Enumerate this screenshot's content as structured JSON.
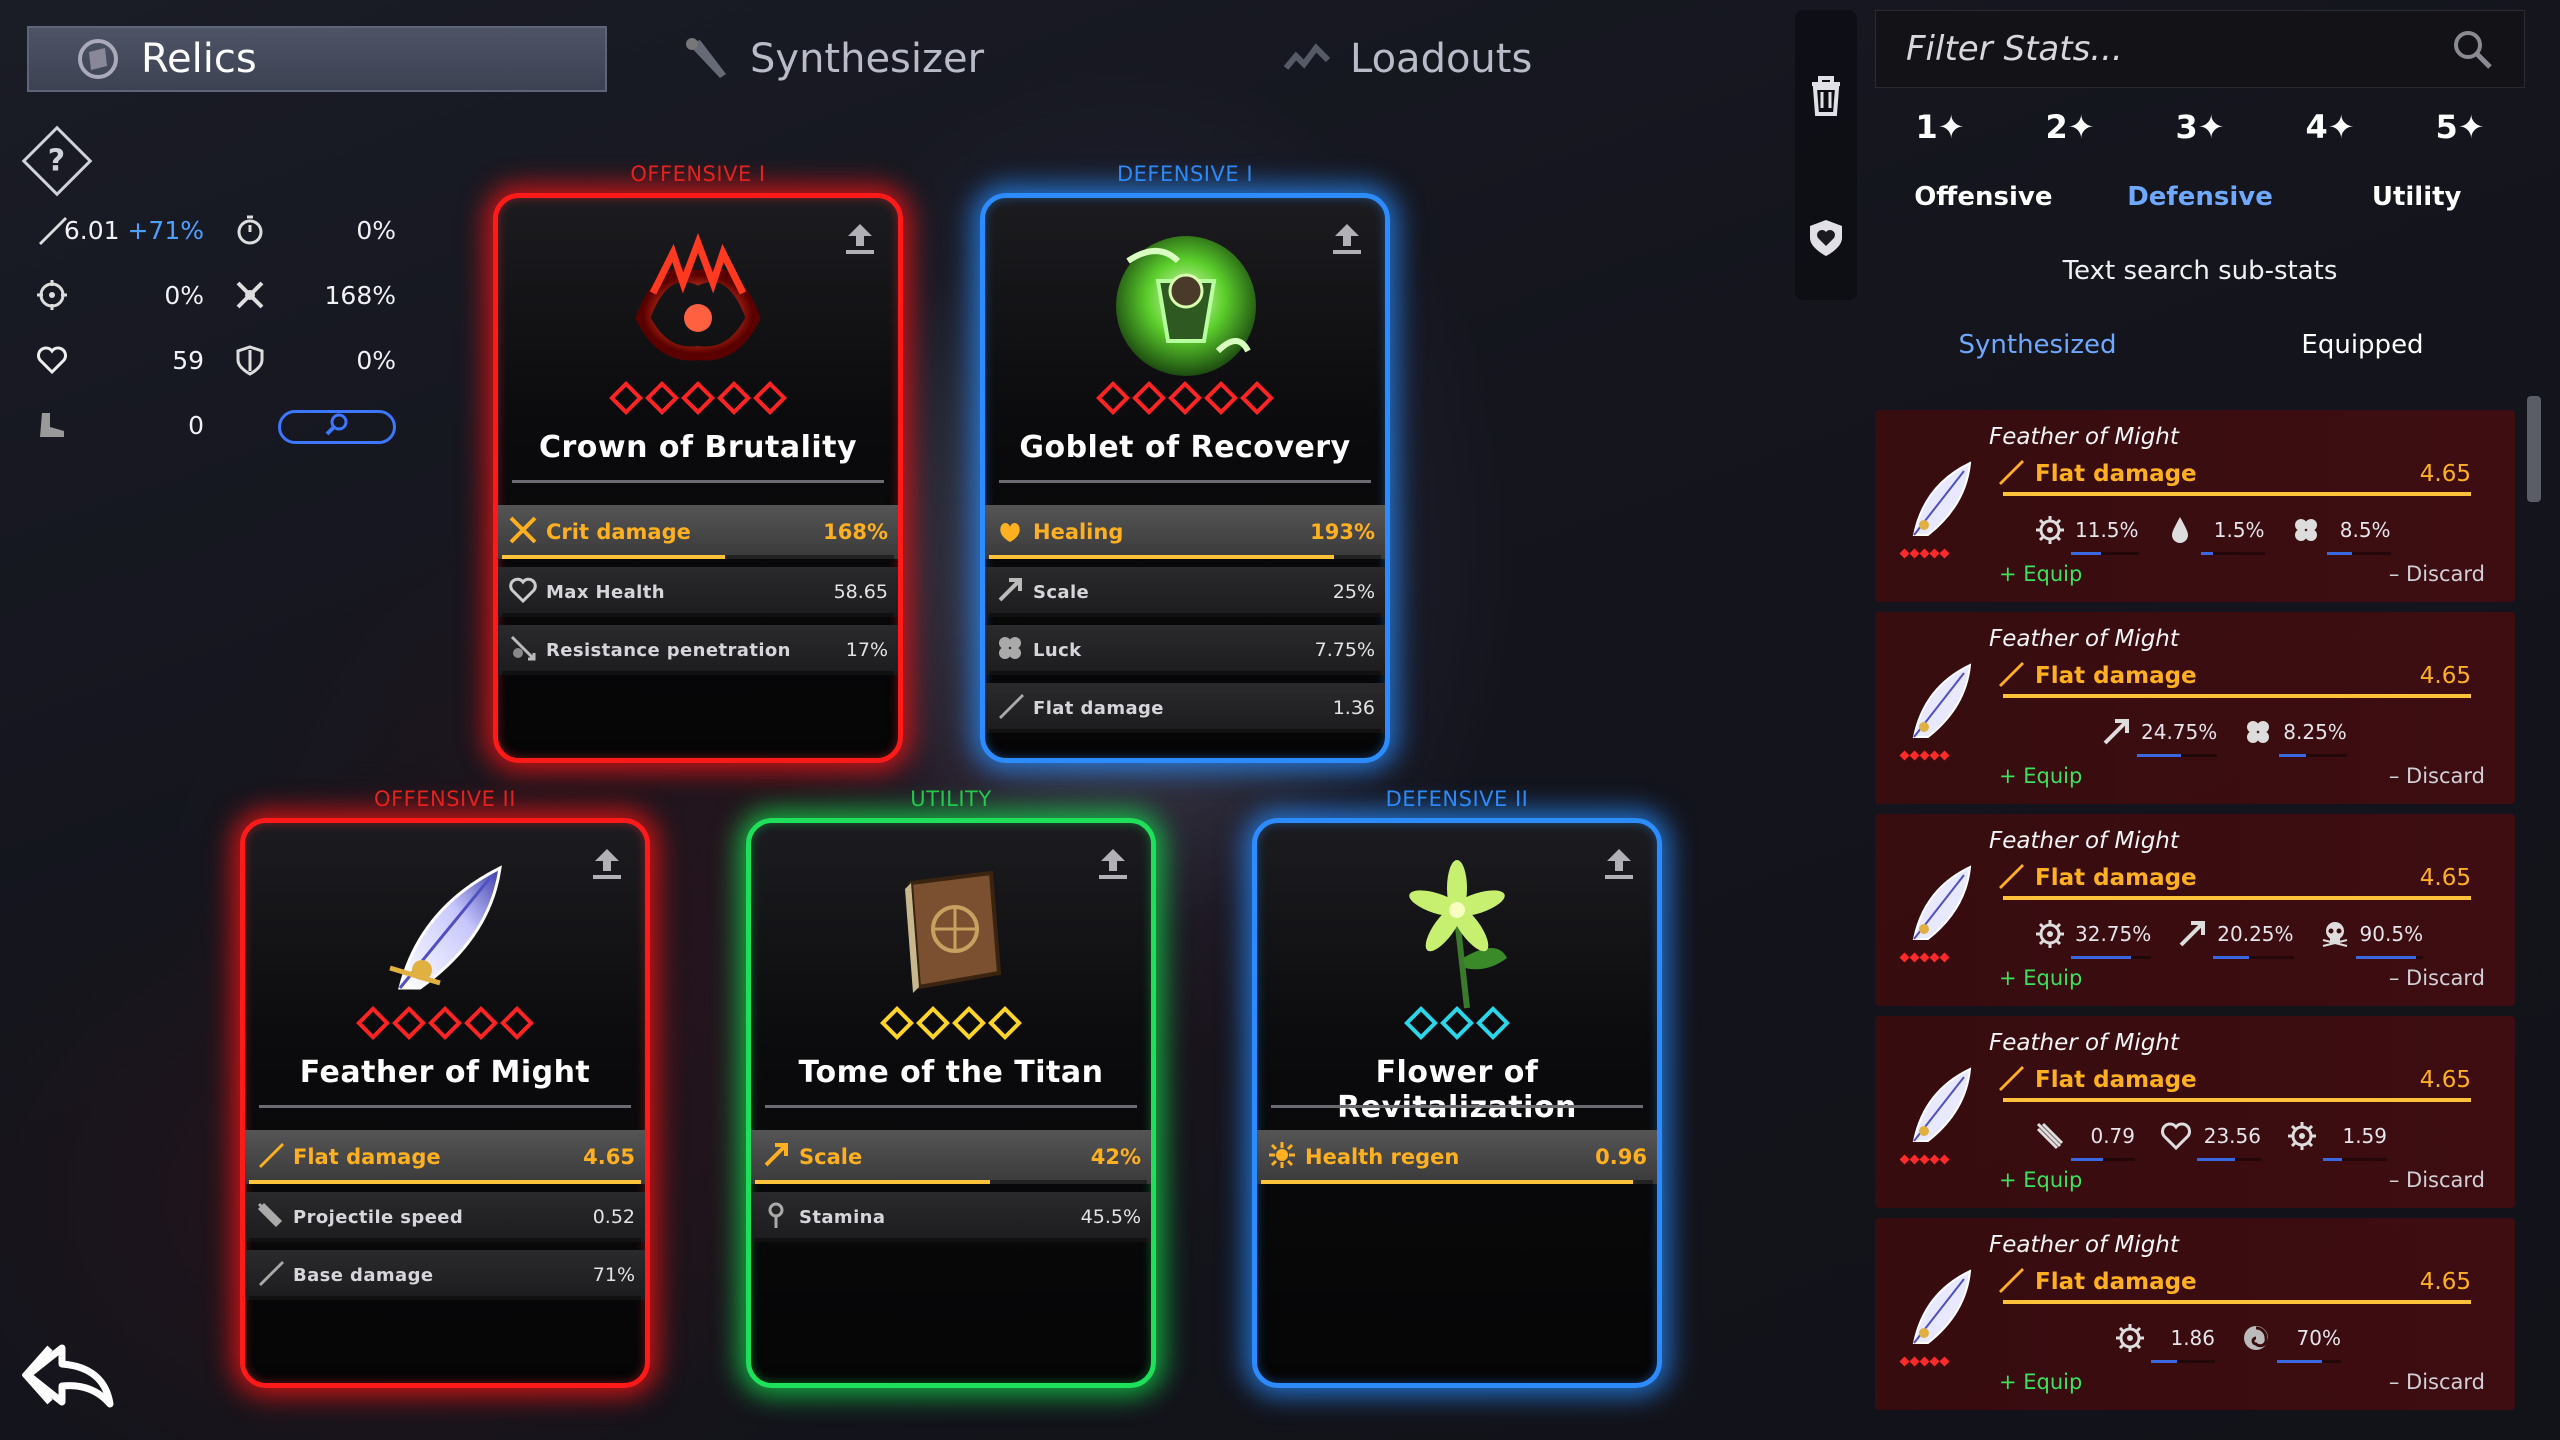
{
  "tabs": [
    {
      "label": "Relics",
      "icon": "relic-icon",
      "active": true
    },
    {
      "label": "Synthesizer",
      "icon": "synthesizer-icon",
      "active": false
    },
    {
      "label": "Loadouts",
      "icon": "loadouts-icon",
      "active": false
    }
  ],
  "help": {
    "label": "?"
  },
  "stats": {
    "damage": {
      "value": "6.01",
      "bonus": "+71%",
      "icon": "sword-icon"
    },
    "cooldown": {
      "value": "0%",
      "icon": "stopwatch-icon"
    },
    "crit_chance": {
      "value": "0%",
      "icon": "crosshair-icon"
    },
    "crit_damage": {
      "value": "168%",
      "icon": "crit-burst-icon"
    },
    "health": {
      "value": "59",
      "icon": "heart-icon"
    },
    "armor": {
      "value": "0%",
      "icon": "shield-icon"
    },
    "speed": {
      "value": "0",
      "icon": "boot-icon"
    }
  },
  "cards": [
    {
      "slot": "OFFENSIVE I",
      "name": "Crown of Brutality",
      "stars": 5,
      "star_color": "#ff2424",
      "main": {
        "label": "Crit damage",
        "value": "168%",
        "fill": 0.57
      },
      "subs": [
        {
          "label": "Max Health",
          "value": "58.65",
          "fill": 0.0
        },
        {
          "label": "Resistance penetration",
          "value": "17%",
          "fill": 0.0
        }
      ]
    },
    {
      "slot": "DEFENSIVE I",
      "name": "Goblet of Recovery",
      "stars": 5,
      "star_color": "#ff2424",
      "main": {
        "label": "Healing",
        "value": "193%",
        "fill": 0.88
      },
      "subs": [
        {
          "label": "Scale",
          "value": "25%",
          "fill": 0.0
        },
        {
          "label": "Luck",
          "value": "7.75%",
          "fill": 0.0
        },
        {
          "label": "Flat damage",
          "value": "1.36",
          "fill": 0.0
        }
      ]
    },
    {
      "slot": "OFFENSIVE II",
      "name": "Feather of Might",
      "stars": 5,
      "star_color": "#ff2424",
      "main": {
        "label": "Flat damage",
        "value": "4.65",
        "fill": 1.0
      },
      "subs": [
        {
          "label": "Projectile speed",
          "value": "0.52",
          "fill": 0.0
        },
        {
          "label": "Base damage",
          "value": "71%",
          "fill": 0.0
        }
      ]
    },
    {
      "slot": "UTILITY",
      "name": "Tome of the Titan",
      "stars": 4,
      "star_color": "#ffd52a",
      "main": {
        "label": "Scale",
        "value": "42%",
        "fill": 0.6
      },
      "subs": [
        {
          "label": "Stamina",
          "value": "45.5%",
          "fill": 0.0
        }
      ]
    },
    {
      "slot": "DEFENSIVE II",
      "name": "Flower of Revitalization",
      "stars": 3,
      "star_color": "#2ad6e8",
      "main": {
        "label": "Health regen",
        "value": "0.96",
        "fill": 0.95
      },
      "subs": []
    }
  ],
  "toolbar": {
    "delete_icon": "trash-icon",
    "shield_icon": "shield-heart-icon"
  },
  "filter": {
    "placeholder": "Filter Stats...",
    "tiers": [
      "1✦",
      "2✦",
      "3✦",
      "4✦",
      "5✦"
    ],
    "categories": [
      {
        "label": "Offensive",
        "color": "#ffffff"
      },
      {
        "label": "Defensive",
        "color": "#6fa8ff"
      },
      {
        "label": "Utility",
        "color": "#ffffff"
      }
    ],
    "text_search": "Text search sub-stats",
    "sort": [
      {
        "label": "Synthesized",
        "color": "#6fa8ff"
      },
      {
        "label": "Equipped",
        "color": "#ffffff"
      }
    ]
  },
  "inventory": [
    {
      "name": "Feather of Might",
      "stat": "Flat damage",
      "value": "4.65",
      "subs": [
        {
          "icon": "gear-icon",
          "value": "11.5%"
        },
        {
          "icon": "drop-icon",
          "value": "1.5%"
        },
        {
          "icon": "clover-icon",
          "value": "8.5%"
        }
      ]
    },
    {
      "name": "Feather of Might",
      "stat": "Flat damage",
      "value": "4.65",
      "subs": [
        {
          "icon": "scale-arrow-icon",
          "value": "24.75%"
        },
        {
          "icon": "clover-icon",
          "value": "8.25%"
        }
      ]
    },
    {
      "name": "Feather of Might",
      "stat": "Flat damage",
      "value": "4.65",
      "subs": [
        {
          "icon": "gear-icon",
          "value": "32.75%"
        },
        {
          "icon": "scale-arrow-icon",
          "value": "20.25%"
        },
        {
          "icon": "skull-icon",
          "value": "90.5%"
        }
      ]
    },
    {
      "name": "Feather of Might",
      "stat": "Flat damage",
      "value": "4.65",
      "subs": [
        {
          "icon": "projectile-icon",
          "value": "0.79"
        },
        {
          "icon": "heart-icon",
          "value": "23.56"
        },
        {
          "icon": "gear-icon",
          "value": "1.59"
        }
      ]
    },
    {
      "name": "Feather of Might",
      "stat": "Flat damage",
      "value": "4.65",
      "subs": [
        {
          "icon": "gear-icon",
          "value": "1.86"
        },
        {
          "icon": "vortex-icon",
          "value": "70%"
        }
      ]
    }
  ],
  "inventory_actions": {
    "equip": "+ Equip",
    "discard": "– Discard"
  }
}
